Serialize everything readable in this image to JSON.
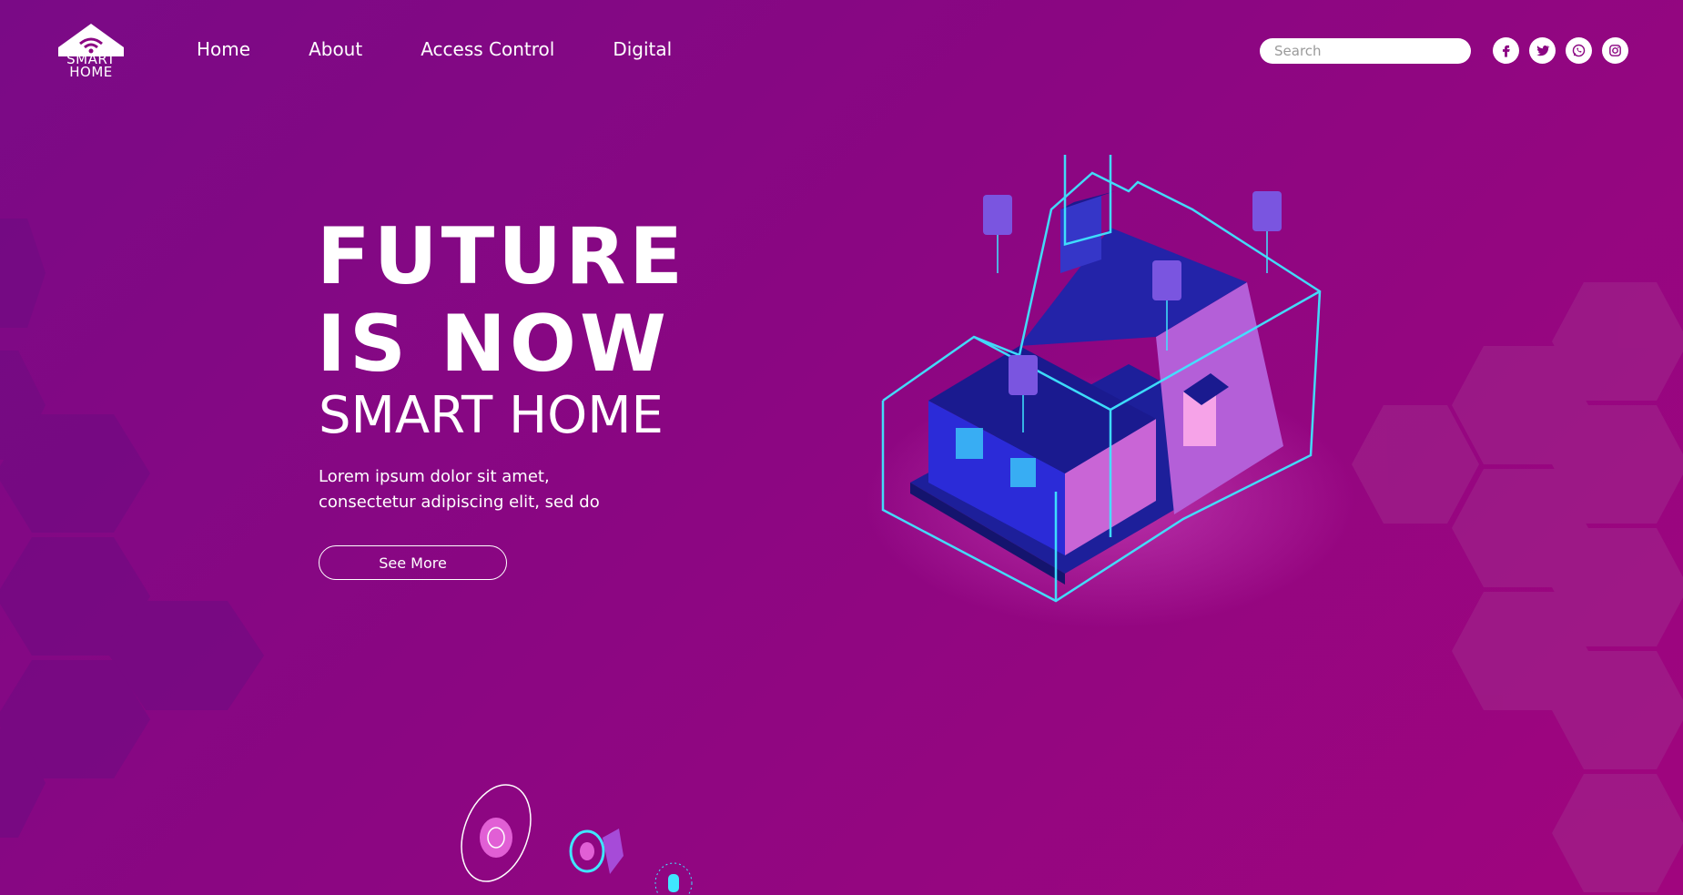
{
  "brand": {
    "line1": "SMART",
    "line2": "HOME"
  },
  "nav": [
    {
      "label": "Home"
    },
    {
      "label": "About"
    },
    {
      "label": "Access Control"
    },
    {
      "label": "Digital"
    }
  ],
  "search": {
    "placeholder": "Search"
  },
  "social": [
    "facebook-icon",
    "twitter-icon",
    "whatsapp-icon",
    "instagram-icon"
  ],
  "hero": {
    "line1": "FUTURE",
    "line2": "IS NOW",
    "subtitle": "SMART HOME",
    "description": "Lorem ipsum dolor sit amet, consectetur adipiscing elit, sed do",
    "button": "See More"
  },
  "colors": {
    "background": "#8b0682",
    "accent_cyan": "#3fe6ff",
    "house_blue": "#1a1a9e",
    "house_pink": "#e36bd8"
  }
}
